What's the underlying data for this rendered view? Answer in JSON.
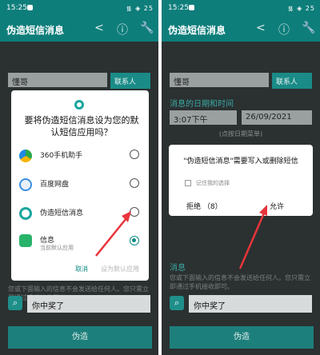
{
  "left": {
    "status": {
      "time": "15:25",
      "system": "᯾ ◈ 25"
    },
    "app_title": "伪造短信消息",
    "contact_value": "懂哥",
    "contact_button": "联系人",
    "message_hint": "您或下面输入的信息不会发送给任何人。您只需立即通过手机接收即可。",
    "message_value": "你中奖了",
    "send_button": "伪造",
    "dialog": {
      "title": "要将伪造短信消息设为您的默认短信应用吗？",
      "options": [
        {
          "label": "360手机助手",
          "sub": ""
        },
        {
          "label": "百度网盘",
          "sub": ""
        },
        {
          "label": "伪造短信消息",
          "sub": ""
        },
        {
          "label": "信息",
          "sub": "当前默认应用"
        }
      ],
      "cancel": "取消",
      "set_default": "设为默认应用"
    }
  },
  "right": {
    "status": {
      "time": "15:25",
      "system": "᯾ ◈ 25"
    },
    "app_title": "伪造短信消息",
    "contact_value": "懂哥",
    "contact_button": "联系人",
    "section_datetime": "消息的日期和时间",
    "time_value": "3:07下午",
    "date_value": "26/09/2021",
    "datetime_hint": "(点按日期菜单)",
    "section_message": "消息",
    "message_hint": "您或下面输入的信息不会发送给任何人。您只需立即通过手机接收即可。",
    "message_value": "你中奖了",
    "send_button": "伪造",
    "dialog": {
      "title": "\"伪造短信消息\"需要写入或删除短信",
      "remember": "记住我的选择",
      "deny": "拒绝 （8）",
      "allow": "允许"
    }
  },
  "colors": {
    "primary": "#0e7e7b",
    "accent": "#1a8b87",
    "arrow": "#e8353b"
  }
}
